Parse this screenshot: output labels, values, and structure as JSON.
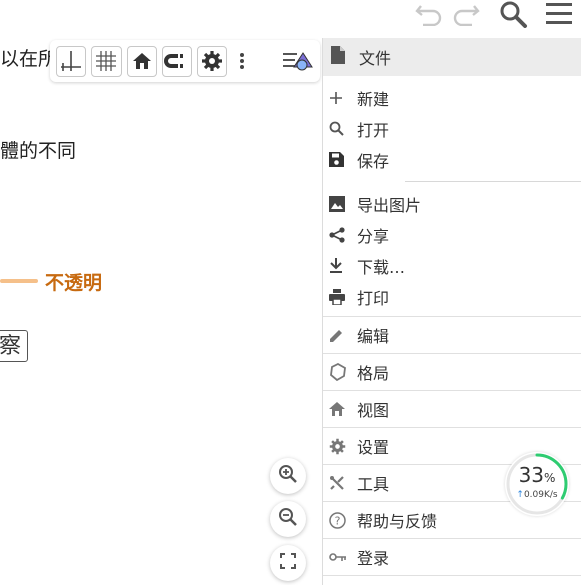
{
  "canvas": {
    "text_top": "以在所",
    "text_middle": "體的不同",
    "opacity_label": "不透明",
    "observe_text": "察"
  },
  "toolbar": {
    "icons": [
      "axes-icon",
      "grid-icon",
      "home-icon",
      "magnet-icon",
      "gear-icon",
      "more-icon",
      "style-icon"
    ]
  },
  "menu": {
    "header": "文件",
    "file_items": [
      {
        "label": "新建",
        "icon": "plus-icon"
      },
      {
        "label": "打开",
        "icon": "search-icon"
      },
      {
        "label": "保存",
        "icon": "save-icon"
      }
    ],
    "export_items": [
      {
        "label": "导出图片",
        "icon": "image-icon"
      },
      {
        "label": "分享",
        "icon": "share-icon"
      },
      {
        "label": "下载…",
        "icon": "download-icon"
      },
      {
        "label": "打印",
        "icon": "print-icon"
      }
    ],
    "categories": [
      {
        "label": "编辑",
        "icon": "pencil-icon"
      },
      {
        "label": "格局",
        "icon": "perspective-icon"
      },
      {
        "label": "视图",
        "icon": "home-icon"
      },
      {
        "label": "设置",
        "icon": "gear-icon"
      },
      {
        "label": "工具",
        "icon": "tools-icon"
      },
      {
        "label": "帮助与反馈",
        "icon": "help-icon"
      },
      {
        "label": "登录",
        "icon": "login-icon"
      }
    ]
  },
  "network": {
    "percent": "33",
    "percent_sign": "%",
    "speed": "0.09K/s",
    "progress": 0.33,
    "color": "#2ecc71"
  },
  "colors": {
    "accent_orange": "#c76a10",
    "slider": "#f5c08a",
    "menu_header_bg": "#ececec"
  }
}
